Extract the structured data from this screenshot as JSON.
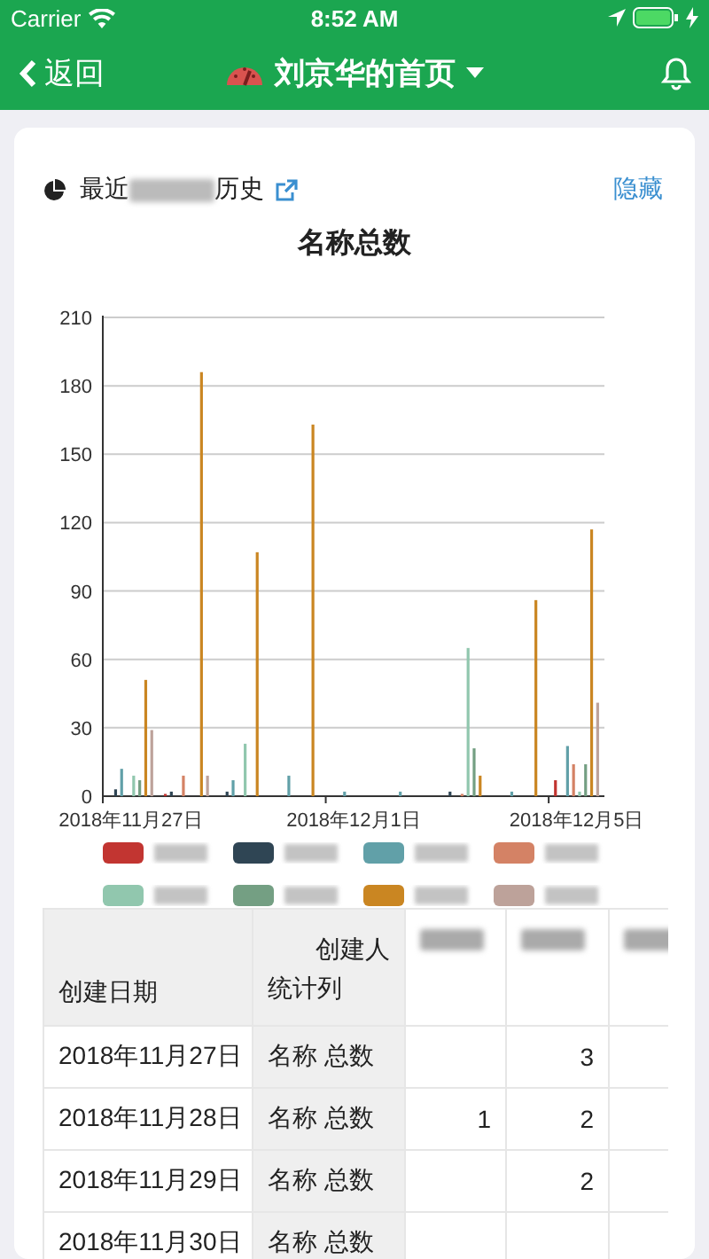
{
  "status_bar": {
    "carrier": "Carrier",
    "time": "8:52 AM"
  },
  "nav": {
    "back": "返回",
    "title": "刘京华的首页"
  },
  "card": {
    "title_start": "最近",
    "title_end": "历史",
    "hide": "隐藏",
    "chart_title": "名称总数",
    "chart_data": {
      "type": "bar",
      "grid": true,
      "ylim": [
        0,
        210
      ],
      "yticks": [
        0,
        30,
        60,
        90,
        120,
        150,
        180,
        210
      ],
      "categories": [
        "2018年11月27日",
        null,
        null,
        null,
        "2018年12月1日",
        null,
        null,
        null,
        "2018年12月5日"
      ],
      "series": [
        {
          "color": "#c23531",
          "values": [
            null,
            1,
            null,
            null,
            null,
            null,
            null,
            null,
            7
          ]
        },
        {
          "color": "#2f4554",
          "values": [
            3,
            2,
            2,
            null,
            null,
            null,
            2,
            null,
            null
          ]
        },
        {
          "color": "#61a0a8",
          "values": [
            12,
            null,
            7,
            9,
            2,
            2,
            null,
            2,
            22
          ]
        },
        {
          "color": "#d48265",
          "values": [
            null,
            9,
            null,
            null,
            null,
            null,
            1,
            null,
            14
          ]
        },
        {
          "color": "#91c7ae",
          "values": [
            9,
            null,
            23,
            null,
            null,
            null,
            65,
            null,
            2
          ]
        },
        {
          "color": "#749f83",
          "values": [
            7,
            null,
            null,
            null,
            null,
            null,
            21,
            null,
            14
          ]
        },
        {
          "color": "#ca8622",
          "values": [
            51,
            186,
            107,
            163,
            null,
            null,
            9,
            86,
            117
          ]
        },
        {
          "color": "#bda29a",
          "values": [
            29,
            9,
            null,
            null,
            null,
            null,
            null,
            null,
            41
          ]
        }
      ]
    }
  },
  "table": {
    "columns": [
      {
        "lines": [
          "创建日期"
        ]
      },
      {
        "lines": [
          "创建人",
          "统计列"
        ]
      }
    ],
    "rows": [
      {
        "date": "2018年11月27日",
        "label": "名称 总数",
        "cells": [
          null,
          "3",
          null
        ]
      },
      {
        "date": "2018年11月28日",
        "label": "名称 总数",
        "cells": [
          "1",
          "2",
          null
        ]
      },
      {
        "date": "2018年11月29日",
        "label": "名称 总数",
        "cells": [
          null,
          "2",
          null
        ]
      },
      {
        "date": "2018年11月30日",
        "label": "名称 总数",
        "cells": [
          null,
          null,
          null
        ]
      }
    ]
  }
}
